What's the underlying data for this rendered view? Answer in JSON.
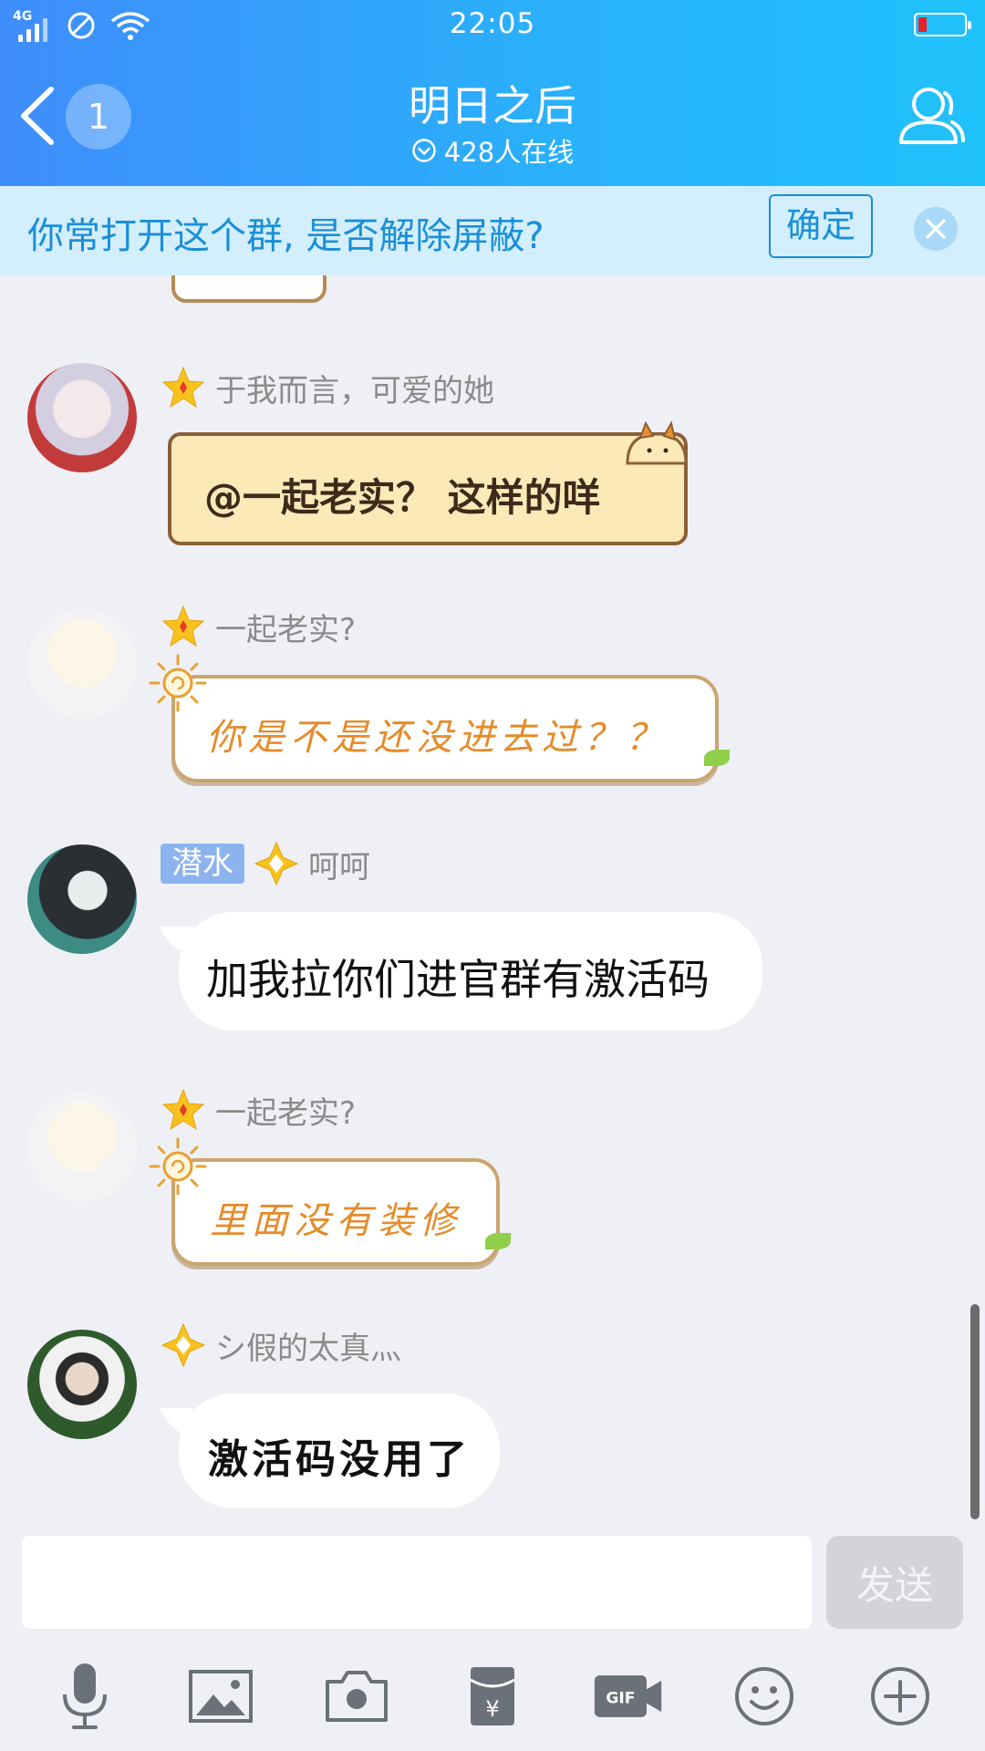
{
  "status_bar": {
    "network": "4G",
    "time": "22:05"
  },
  "header": {
    "unread_count": "1",
    "group_name": "明日之后",
    "online_count": "428人在线"
  },
  "notice": {
    "text": "你常打开这个群, 是否解除屏蔽?",
    "confirm_label": "确定"
  },
  "messages": [
    {
      "sender": "于我而言，可爱的她",
      "text": "@一起老实？ 这样的咩"
    },
    {
      "sender": "一起老实?",
      "text": "你是不是还没进去过？？"
    },
    {
      "tag": "潜水",
      "sender": "呵呵",
      "text": "加我拉你们进官群有激活码"
    },
    {
      "sender": "一起老实?",
      "text": "里面没有装修"
    },
    {
      "sender": "シ假的太真灬",
      "text": "激活码没用了"
    }
  ],
  "composer": {
    "input_value": "",
    "send_label": "发送"
  },
  "toolbar": {
    "items": [
      "mic-icon",
      "image-icon",
      "camera-icon",
      "red-packet-icon",
      "gif-icon",
      "emoji-icon",
      "plus-icon"
    ]
  },
  "colors": {
    "header_start": "#3f8dfb",
    "header_end": "#20c2fb",
    "notice_bg": "#d3eefc",
    "notice_text": "#1a8fd7",
    "chat_bg": "#eff0f5"
  }
}
